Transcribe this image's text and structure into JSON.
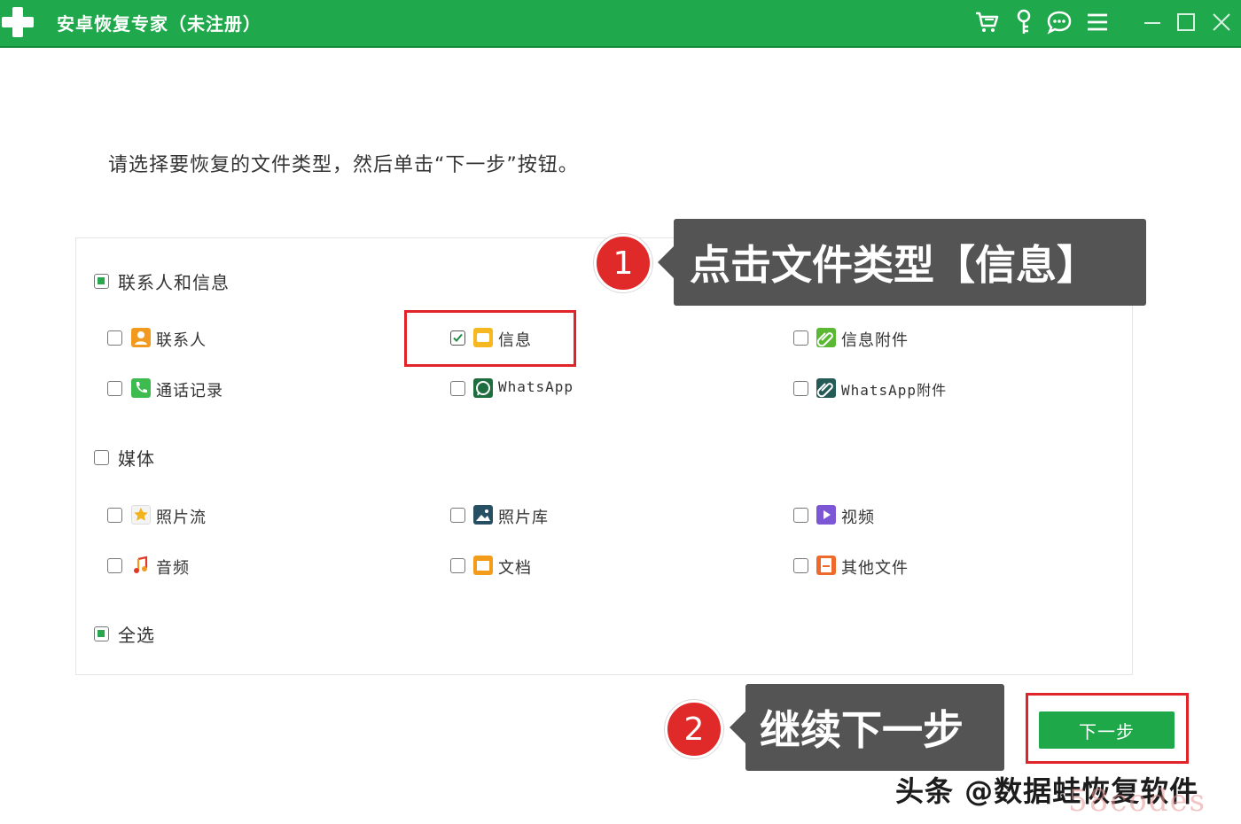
{
  "window": {
    "title": "安卓恢复专家（未注册）",
    "toolbar_icons": [
      "cart-icon",
      "key-icon",
      "chat-icon",
      "menu-icon"
    ],
    "controls": [
      "minimize-icon",
      "maximize-icon",
      "close-icon"
    ]
  },
  "instruction": "请选择要恢复的文件类型，然后单击“下一步”按钮。",
  "groups": {
    "contacts_messages": {
      "label": "联系人和信息",
      "state": "partial",
      "items": {
        "contacts": {
          "label": "联系人",
          "checked": false,
          "icon": "contact-icon"
        },
        "messages": {
          "label": "信息",
          "checked": true,
          "icon": "message-icon"
        },
        "message_attachments": {
          "label": "信息附件",
          "checked": false,
          "icon": "attachment-icon"
        },
        "call_log": {
          "label": "通话记录",
          "checked": false,
          "icon": "phone-icon"
        },
        "whatsapp": {
          "label": "WhatsApp",
          "checked": false,
          "icon": "whatsapp-icon"
        },
        "whatsapp_attachments": {
          "label": "WhatsApp附件",
          "checked": false,
          "icon": "whatsapp-attachment-icon"
        }
      }
    },
    "media": {
      "label": "媒体",
      "state": "unchecked",
      "items": {
        "photo_stream": {
          "label": "照片流",
          "checked": false,
          "icon": "star-icon"
        },
        "photo_library": {
          "label": "照片库",
          "checked": false,
          "icon": "image-icon"
        },
        "video": {
          "label": "视频",
          "checked": false,
          "icon": "video-icon"
        },
        "audio": {
          "label": "音频",
          "checked": false,
          "icon": "music-icon"
        },
        "documents": {
          "label": "文档",
          "checked": false,
          "icon": "folder-icon"
        },
        "other_files": {
          "label": "其他文件",
          "checked": false,
          "icon": "file-icon"
        }
      }
    },
    "select_all": {
      "label": "全选",
      "state": "partial"
    }
  },
  "next_button": "下一步",
  "annotations": {
    "step1": {
      "number": "1",
      "text": "点击文件类型【信息】"
    },
    "step2": {
      "number": "2",
      "text": "继续下一步"
    }
  },
  "watermark": "头条 @数据蛙恢复软件",
  "watermark2": "58codes",
  "colors": {
    "brand_green": "#20a84c",
    "highlight_red": "#e0242a",
    "callout_gray": "#545454"
  }
}
